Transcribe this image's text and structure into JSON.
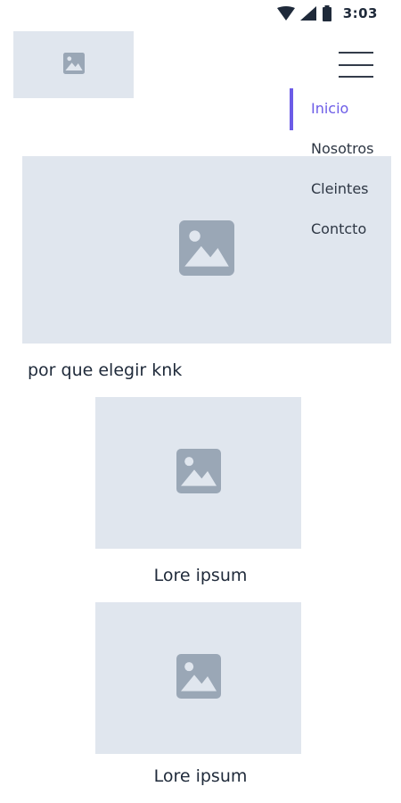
{
  "status_bar": {
    "time": "3:03",
    "icons": [
      "wifi-icon",
      "signal-icon",
      "battery-icon"
    ]
  },
  "header": {
    "logo_icon": "image-placeholder-icon",
    "menu_icon": "hamburger-icon"
  },
  "nav": {
    "items": [
      {
        "label": "Inicio",
        "active": true
      },
      {
        "label": "Nosotros",
        "active": false
      },
      {
        "label": "Cleintes",
        "active": false
      },
      {
        "label": "Contcto",
        "active": false
      }
    ],
    "accent_color": "#6c5ce7"
  },
  "hero": {
    "icon": "image-placeholder-icon"
  },
  "main": {
    "section_title": "por que elegir knk",
    "cards": [
      {
        "caption": "Lore ipsum",
        "icon": "image-placeholder-icon"
      },
      {
        "caption": "Lore ipsum",
        "icon": "image-placeholder-icon"
      }
    ]
  },
  "colors": {
    "placeholder_bg": "#e0e6ee",
    "placeholder_icon": "#9aa7b6",
    "text": "#1f2a3a"
  }
}
